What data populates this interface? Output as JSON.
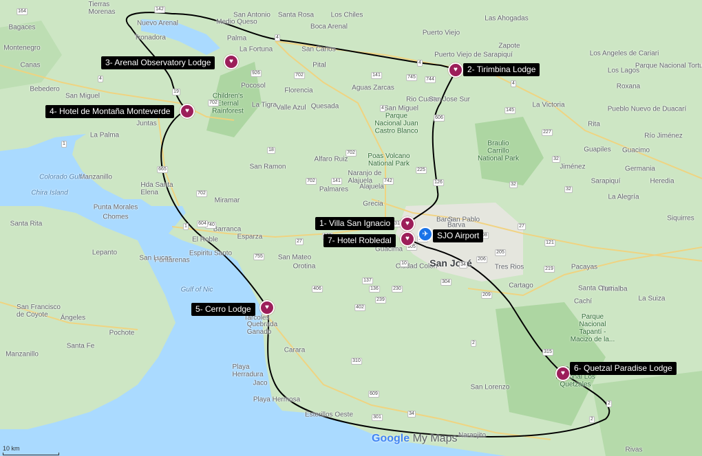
{
  "places": [
    {
      "text": "Tierras\nMorenas"
    },
    {
      "text": "San Antonio"
    },
    {
      "text": "Medio Queso"
    },
    {
      "text": "Santa Rosa"
    },
    {
      "text": "Los Chiles"
    },
    {
      "text": "Las Ahogadas"
    },
    {
      "text": "Bagaces"
    },
    {
      "text": "Nuevo Arenal"
    },
    {
      "text": "Boca Arenal"
    },
    {
      "text": "Tronadora"
    },
    {
      "text": "Palma"
    },
    {
      "text": "Puerto Viejo"
    },
    {
      "text": "Montenegro"
    },
    {
      "text": "La Fortuna"
    },
    {
      "text": "San Carlos"
    },
    {
      "text": "Zapote"
    },
    {
      "text": "Canas"
    },
    {
      "text": "Puerto Viejo de Sarapiquí"
    },
    {
      "text": "Parque Nacional Tortuguero"
    },
    {
      "text": "Los Angeles de Cariari"
    },
    {
      "text": "Bebedero"
    },
    {
      "text": "San Miguel"
    },
    {
      "text": "Pital"
    },
    {
      "text": "Florencia"
    },
    {
      "text": "Aguas Zarcas"
    },
    {
      "text": "Los Lagos"
    },
    {
      "text": "Roxana"
    },
    {
      "text": "Pocosol"
    },
    {
      "text": "Quesada"
    },
    {
      "text": "Rio Cuarto"
    },
    {
      "text": "San Jose Sur"
    },
    {
      "text": "La Victoria"
    },
    {
      "text": "Pueblo Nuevo de Duacarí"
    },
    {
      "text": "San Miguel"
    },
    {
      "text": "La Tigra"
    },
    {
      "text": "Valle Azul"
    },
    {
      "text": "Juntas"
    },
    {
      "text": "Rita"
    },
    {
      "text": "La Palma"
    },
    {
      "text": "San Ramon"
    },
    {
      "text": "Guapiles"
    },
    {
      "text": "Guacimo"
    },
    {
      "text": "Río Jiménez"
    },
    {
      "text": "Alfaro Ruiz"
    },
    {
      "text": "Jiménez"
    },
    {
      "text": "Germania"
    },
    {
      "text": "Manzanillo"
    },
    {
      "text": "Hda Santa\nElena"
    },
    {
      "text": "Naranjo de\nAlajuela"
    },
    {
      "text": "Heredia"
    },
    {
      "text": "Sarapiquí"
    },
    {
      "text": "Alajuela"
    },
    {
      "text": "La Alegría"
    },
    {
      "text": "Palmares"
    },
    {
      "text": "Grecia"
    },
    {
      "text": "Miramar"
    },
    {
      "text": "Punta Morales"
    },
    {
      "text": "Chomes"
    },
    {
      "text": "Barca"
    },
    {
      "text": "Santa Rita"
    },
    {
      "text": "Barranca"
    },
    {
      "text": "Esparza"
    },
    {
      "text": "San Pablo"
    },
    {
      "text": "Barva"
    },
    {
      "text": "Siquirres"
    },
    {
      "text": "Guácima"
    },
    {
      "text": "El Roble"
    },
    {
      "text": "Lepanto"
    },
    {
      "text": "Puntarenas"
    },
    {
      "text": "Espiritu Santo"
    },
    {
      "text": "San Mateo"
    },
    {
      "text": "Orotina"
    },
    {
      "text": "Ciudad Colón"
    },
    {
      "text": "San Lucas"
    },
    {
      "text": "Tres Rios"
    },
    {
      "text": "Pacayas"
    },
    {
      "text": "Santa Cruz"
    },
    {
      "text": "Turrialba"
    },
    {
      "text": "Cartago"
    },
    {
      "text": "La Suiza"
    },
    {
      "text": "San Francisco\nde Coyote"
    },
    {
      "text": "Tarcoles"
    },
    {
      "text": "Cachí"
    },
    {
      "text": "Ángeles"
    },
    {
      "text": "Pochote"
    },
    {
      "text": "Quebrada\nGanado"
    },
    {
      "text": "Carara"
    },
    {
      "text": "Santa Fe"
    },
    {
      "text": "Manzanillo"
    },
    {
      "text": "Playa\nHerradura"
    },
    {
      "text": "Jaco"
    },
    {
      "text": "San Lorenzo"
    },
    {
      "text": "Playa Hermosa"
    },
    {
      "text": "Esterillos Oeste"
    },
    {
      "text": "Naranjito"
    },
    {
      "text": "Rivas"
    }
  ],
  "cities": [
    {
      "text": "San José"
    }
  ],
  "parks": [
    {
      "text": "Children's\nEternal\nRainforest"
    },
    {
      "text": "Parque\nNacional Juan\nCastro Blanco"
    },
    {
      "text": "Poas Volcano\nNational Park"
    },
    {
      "text": "Braulio\nCarrillo\nNational Park"
    },
    {
      "text": "Parque\nNacional\nTapantí -\nMacizo de la..."
    },
    {
      "text": "Parque\nNacional Los\nQuetzales"
    }
  ],
  "waters": [
    {
      "text": "Colorado Gulf"
    },
    {
      "text": "Chira Island"
    },
    {
      "text": "Gulf of Nic"
    }
  ],
  "roads": [
    "164",
    "142",
    "4",
    "4",
    "4",
    "926",
    "702",
    "141",
    "745",
    "744",
    "4",
    "19",
    "702",
    "4",
    "606",
    "145",
    "1",
    "18",
    "702",
    "227",
    "32",
    "225",
    "126",
    "702",
    "141",
    "742",
    "32",
    "665",
    "702",
    "740",
    "1",
    "131",
    "32",
    "150",
    "108",
    "604",
    "27",
    "105",
    "101",
    "205",
    "27",
    "121",
    "135",
    "755",
    "206",
    "219",
    "137",
    "136",
    "230",
    "406",
    "10",
    "34",
    "239",
    "209",
    "2",
    "402",
    "310",
    "304",
    "315",
    "2",
    "609",
    "2",
    "301",
    "34",
    "2"
  ],
  "stops": [
    {
      "label": "1- Villa San Ignacio"
    },
    {
      "label": "2- Tirimbina Lodge"
    },
    {
      "label": "3- Arenal Observatory Lodge"
    },
    {
      "label": "4- Hotel de Montaña Monteverde"
    },
    {
      "label": "5- Cerro Lodge"
    },
    {
      "label": "6- Quetzal Paradise Lodge"
    },
    {
      "label": "7- Hotel Robledal"
    }
  ],
  "airport": {
    "label": "SJO Airport",
    "icon": "airplane-icon"
  },
  "scale": {
    "text": "10 km"
  },
  "branding": {
    "google": "Google",
    "product": "My Maps"
  },
  "colors": {
    "marker": "#9c1e5a",
    "route": "#000000",
    "airport": "#1a73e8",
    "land": "#cde6c4",
    "forest": "#9fcf93",
    "water": "#aadaff"
  }
}
